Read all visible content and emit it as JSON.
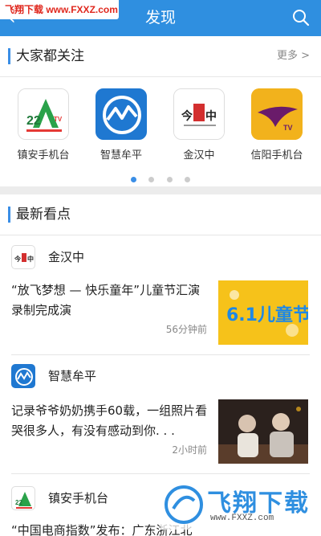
{
  "watermark_top": "飞翔下载 www.FXXZ.com",
  "header": {
    "title": "发现"
  },
  "popular": {
    "title": "大家都关注",
    "more": "更多 >",
    "apps": [
      {
        "name": "镇安手机台",
        "icon": "zhenan-tv-logo"
      },
      {
        "name": "智慧牟平",
        "icon": "zhihui-muping-logo"
      },
      {
        "name": "金汉中",
        "icon": "jin-hanzhong-logo"
      },
      {
        "name": "信阳手机台",
        "icon": "xinyang-tv-logo"
      }
    ],
    "page_count": 4,
    "active_page": 1
  },
  "latest": {
    "title": "最新看点",
    "items": [
      {
        "source": "金汉中",
        "text": "“放飞梦想 — 快乐童年”儿童节汇演录制完成演",
        "time": "56分钟前",
        "thumb_text": "6.1儿童节"
      },
      {
        "source": "智慧牟平",
        "text": "记录爷爷奶奶携手60载，一组照片看哭很多人，有没有感动到你. . .",
        "time": "2小时前"
      },
      {
        "source": "镇安手机台",
        "text": "“中国电商指数”发布：广东浙江北"
      }
    ]
  },
  "watermark_bottom": {
    "title": "飞翔下载",
    "url": "www.FXXZ.com"
  }
}
